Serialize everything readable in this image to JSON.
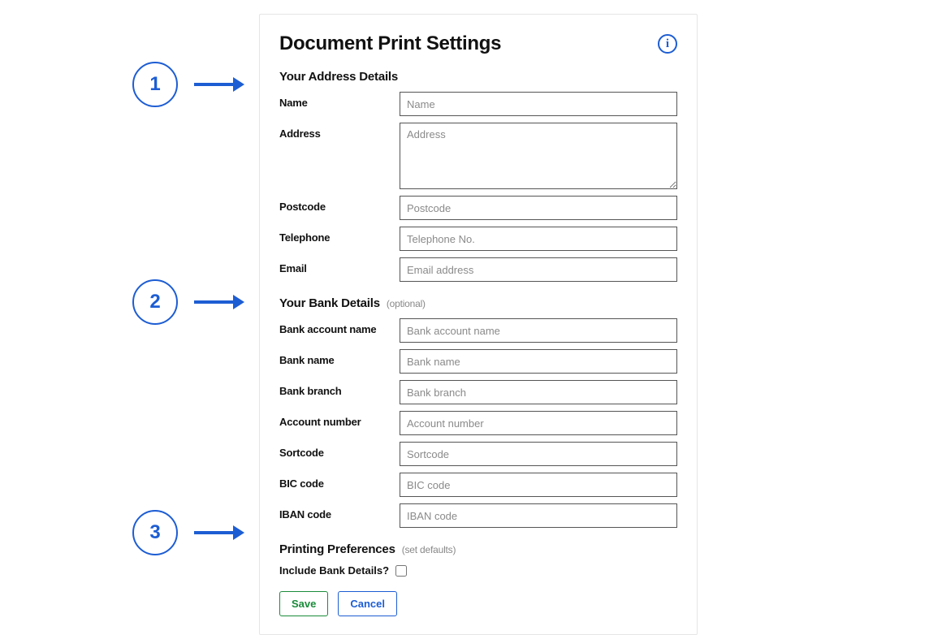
{
  "panel": {
    "title": "Document Print Settings"
  },
  "sections": {
    "address": {
      "heading": "Your Address Details",
      "fields": {
        "name": {
          "label": "Name",
          "placeholder": "Name"
        },
        "address": {
          "label": "Address",
          "placeholder": "Address"
        },
        "postcode": {
          "label": "Postcode",
          "placeholder": "Postcode"
        },
        "telephone": {
          "label": "Telephone",
          "placeholder": "Telephone No."
        },
        "email": {
          "label": "Email",
          "placeholder": "Email address"
        }
      }
    },
    "bank": {
      "heading": "Your Bank Details",
      "note": "(optional)",
      "fields": {
        "account_name": {
          "label": "Bank account name",
          "placeholder": "Bank account name"
        },
        "bank_name": {
          "label": "Bank name",
          "placeholder": "Bank name"
        },
        "bank_branch": {
          "label": "Bank branch",
          "placeholder": "Bank branch"
        },
        "account_number": {
          "label": "Account number",
          "placeholder": "Account number"
        },
        "sortcode": {
          "label": "Sortcode",
          "placeholder": "Sortcode"
        },
        "bic": {
          "label": "BIC code",
          "placeholder": "BIC code"
        },
        "iban": {
          "label": "IBAN code",
          "placeholder": "IBAN code"
        }
      }
    },
    "printing": {
      "heading": "Printing Preferences",
      "note": "(set defaults)",
      "include_bank_label": "Include Bank Details?"
    }
  },
  "buttons": {
    "save": "Save",
    "cancel": "Cancel"
  },
  "callouts": {
    "c1": "1",
    "c2": "2",
    "c3": "3"
  }
}
